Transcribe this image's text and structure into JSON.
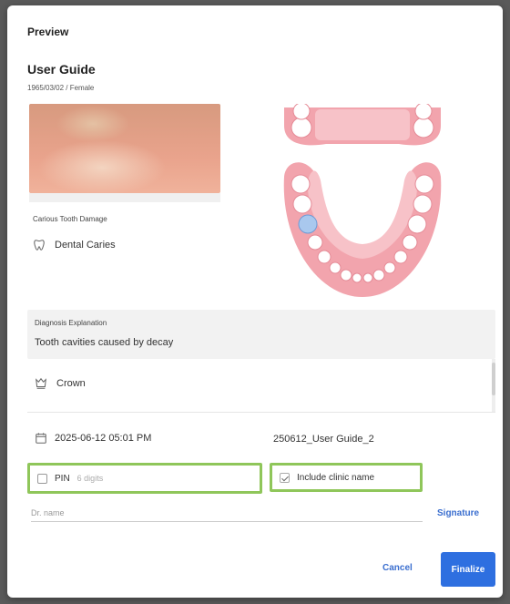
{
  "modal": {
    "title": "Preview"
  },
  "patient": {
    "name": "User Guide",
    "meta": "1965/03/02 / Female"
  },
  "finding": {
    "section_label": "Carious Tooth Damage",
    "item": "Dental Caries",
    "icon": "tooth-icon"
  },
  "explanation": {
    "label": "Diagnosis Explanation",
    "text": "Tooth cavities caused by decay"
  },
  "treatment": {
    "item": "Crown",
    "icon": "crown-icon"
  },
  "meta": {
    "datetime": "2025-06-12 05:01 PM",
    "filename": "250612_User Guide_2"
  },
  "options": {
    "pin_label": "PIN",
    "pin_placeholder": "6 digits",
    "include_clinic_label": "Include clinic name",
    "include_clinic_checked": true
  },
  "doctor": {
    "placeholder": "Dr. name"
  },
  "actions": {
    "signature": "Signature",
    "cancel": "Cancel",
    "finalize": "Finalize"
  },
  "colors": {
    "accent": "#2e6fe0",
    "highlight_border": "#8fc65a",
    "selected_tooth": "#a9c8ee",
    "gum": "#f2a4ad"
  }
}
